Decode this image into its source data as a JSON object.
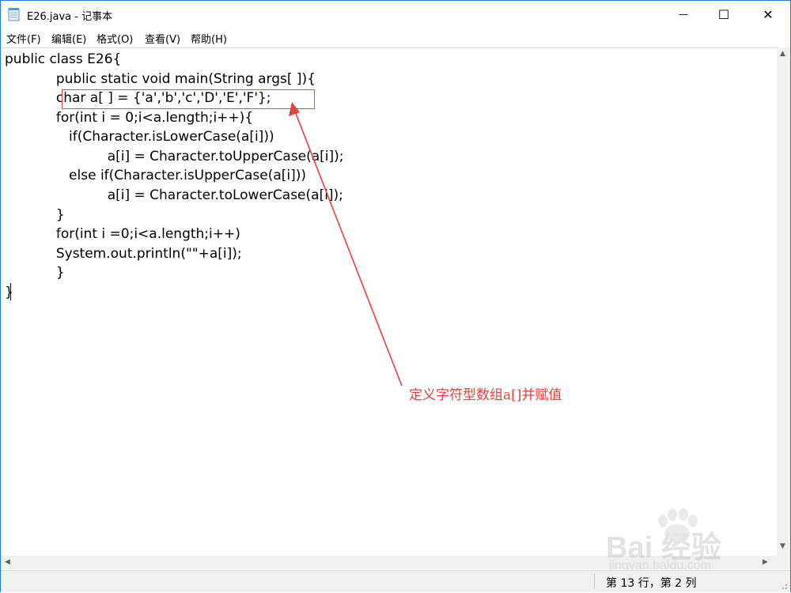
{
  "window": {
    "title": "E26.java - 记事本",
    "minimize_glyph": "—",
    "maximize_glyph": "☐",
    "close_glyph": "✕"
  },
  "menu": {
    "items": [
      {
        "label": "文件(F)"
      },
      {
        "label": "编辑(E)"
      },
      {
        "label": "格式(O)"
      },
      {
        "label": "查看(V)"
      },
      {
        "label": "帮助(H)"
      }
    ]
  },
  "editor": {
    "lines": [
      "public class E26{",
      "            public static void main(String args[ ]){",
      "            char a[ ] = {'a','b','c','D','E','F'};",
      "            for(int i = 0;i<a.length;i++){",
      "               if(Character.isLowerCase(a[i]))",
      "                        a[i] = Character.toUpperCase(a[i]);",
      "               else if(Character.isUpperCase(a[i]))",
      "                        a[i] = Character.toLowerCase(a[i]);",
      "            }",
      "            for(int i =0;i<a.length;i++)",
      "            System.out.println(\"\"+a[i]);",
      "            }",
      "}"
    ]
  },
  "annotation": {
    "text": "定义字符型数组a[]并赋值",
    "color": "#e8403a"
  },
  "statusbar": {
    "position": "第 13 行，第 2 列"
  },
  "watermark": {
    "brand": "Bai 经验",
    "url": "jingyan.baidu.com"
  },
  "icons": {
    "app": "notepad-icon",
    "scroll_up": "scroll-up-arrow-icon",
    "scroll_down": "scroll-down-arrow-icon",
    "scroll_left": "scroll-left-arrow-icon",
    "scroll_right": "scroll-right-arrow-icon"
  }
}
